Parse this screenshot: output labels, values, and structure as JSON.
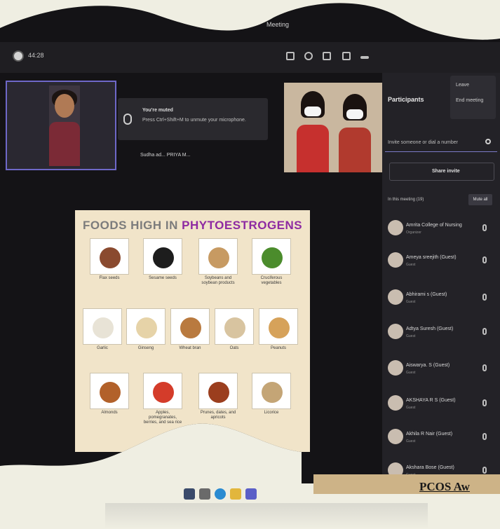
{
  "window": {
    "title": "Meeting"
  },
  "app": {
    "title": "44:28"
  },
  "self_tile": {
    "mute_title": "You're muted",
    "mute_hint": "Press Ctrl+Shift+M to unmute your microphone.",
    "names": "Sudha ad...   PRIYA M...   "
  },
  "panel": {
    "title": "Participants",
    "menu": [
      "Leave",
      "End meeting"
    ],
    "invite_placeholder": "Invite someone or dial a number",
    "share_label": "Share invite",
    "in_meeting": "In this meeting (19)",
    "mute_all": "Mute all",
    "participants": [
      {
        "name": "Amrita College of Nursing",
        "role": "Organizer"
      },
      {
        "name": "Ameya sreejith (Guest)",
        "role": "Guest"
      },
      {
        "name": "Abhirami s (Guest)",
        "role": "Guest"
      },
      {
        "name": "Adtya Suresh (Guest)",
        "role": "Guest"
      },
      {
        "name": "Aiswarya. S (Guest)",
        "role": "Guest"
      },
      {
        "name": "AKSHAYA R S (Guest)",
        "role": "Guest"
      },
      {
        "name": "Akhila R Nair (Guest)",
        "role": "Guest"
      },
      {
        "name": "Akshara Bose (Guest)",
        "role": "Guest"
      }
    ]
  },
  "poster": {
    "title_plain": "FOODS HIGH IN ",
    "title_accent": "PHYTOESTROGENS",
    "foods": [
      {
        "label": "Flax seeds",
        "color": "#8a4a2f"
      },
      {
        "label": "Sesame seeds",
        "color": "#1d1d1d"
      },
      {
        "label": "Soybeans and soybean products",
        "color": "#c79a62"
      },
      {
        "label": "Cruciferous vegetables",
        "color": "#4b8c2c"
      },
      {
        "label": "Garlic",
        "color": "#e8e3d6"
      },
      {
        "label": "Ginseng",
        "color": "#e6d3a8"
      },
      {
        "label": "Wheat bran",
        "color": "#b97a3f"
      },
      {
        "label": "Oats",
        "color": "#d8c4a0"
      },
      {
        "label": "Peanuts",
        "color": "#d6a25a"
      },
      {
        "label": "Almonds",
        "color": "#b2612a"
      },
      {
        "label": "Apples, pomegranates, berries, and sea rice",
        "color": "#d43c2a"
      },
      {
        "label": "Prunes, dates, and apricots",
        "color": "#9b3e1e"
      },
      {
        "label": "Licorice",
        "color": "#c4a576"
      }
    ]
  },
  "banner": {
    "text": "PCOS Aw"
  }
}
